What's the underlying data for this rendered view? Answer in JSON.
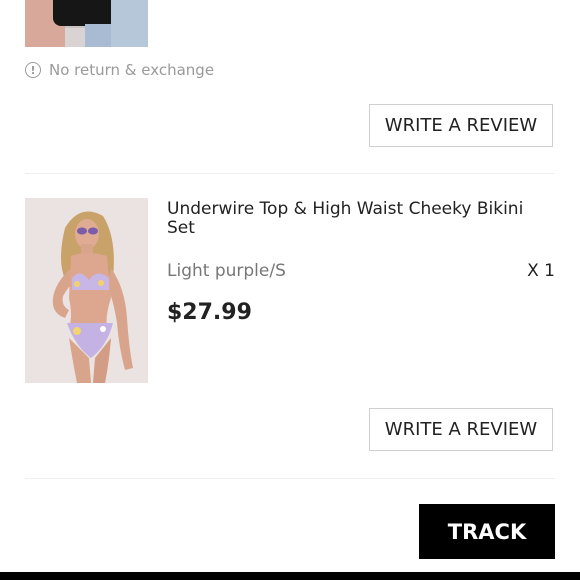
{
  "previous_item": {
    "notice_text": "No return & exchange",
    "notice_icon": "info-circle-icon",
    "review_label": "WRITE A REVIEW"
  },
  "item": {
    "title": "Underwire Top & High Waist Cheeky Bikini Set",
    "variant": "Light purple/S",
    "quantity": "X 1",
    "price": "$27.99",
    "review_label": "WRITE A REVIEW"
  },
  "actions": {
    "track_label": "TRACK"
  },
  "colors": {
    "accent_button_bg": "#000000",
    "border": "#cfcfcf",
    "muted_text": "#9a9a9a"
  }
}
